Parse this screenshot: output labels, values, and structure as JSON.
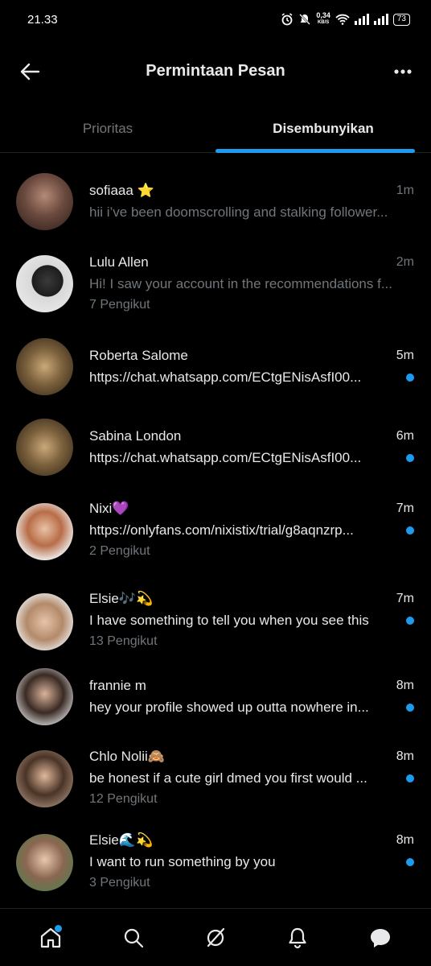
{
  "status_bar": {
    "time": "21.33",
    "net_speed": "0,34",
    "net_unit": "KB/S",
    "battery": "73"
  },
  "header": {
    "title": "Permintaan Pesan"
  },
  "tabs": [
    {
      "label": "Prioritas",
      "active": false
    },
    {
      "label": "Disembunyikan",
      "active": true
    }
  ],
  "conversations": [
    {
      "name": "sofiaaa ⭐",
      "time": "1m",
      "message": "hii i’ve been doomscrolling and stalking follower...",
      "followers": "",
      "unread": false
    },
    {
      "name": "Lulu Allen",
      "time": "2m",
      "message": "Hi! I saw your account in the recommendations f...",
      "followers": "7 Pengikut",
      "unread": false
    },
    {
      "name": "Roberta Salome",
      "time": "5m",
      "message": "https://chat.whatsapp.com/ECtgENisAsfI00...",
      "followers": "",
      "unread": true
    },
    {
      "name": "Sabina London",
      "time": "6m",
      "message": "https://chat.whatsapp.com/ECtgENisAsfI00...",
      "followers": "",
      "unread": true
    },
    {
      "name": "Nixi💜",
      "time": "7m",
      "message": "https://onlyfans.com/nixistix/trial/g8aqnzrp...",
      "followers": "2 Pengikut",
      "unread": true
    },
    {
      "name": "Elsie🎶💫",
      "time": "7m",
      "message": "I have something to tell you when you see this",
      "followers": "13 Pengikut",
      "unread": true
    },
    {
      "name": "frannie m",
      "time": "8m",
      "message": "hey your profile showed up outta nowhere in...",
      "followers": "",
      "unread": true
    },
    {
      "name": "Chlo Nolii🙈",
      "time": "8m",
      "message": "be honest if a cute girl dmed you first would ...",
      "followers": "12 Pengikut",
      "unread": true
    },
    {
      "name": "Elsie🌊💫",
      "time": "8m",
      "message": "I want to run something by you",
      "followers": "3 Pengikut",
      "unread": true
    }
  ],
  "colors": {
    "accent": "#1d9bf0",
    "background": "#000000",
    "primary_text": "#e7e9ea",
    "secondary_text": "#71767b"
  },
  "icons": {
    "back": "arrow-left-icon",
    "more": "more-horizontal-icon",
    "nav": [
      "home-icon",
      "search-icon",
      "grok-icon",
      "bell-icon",
      "messages-icon"
    ]
  }
}
